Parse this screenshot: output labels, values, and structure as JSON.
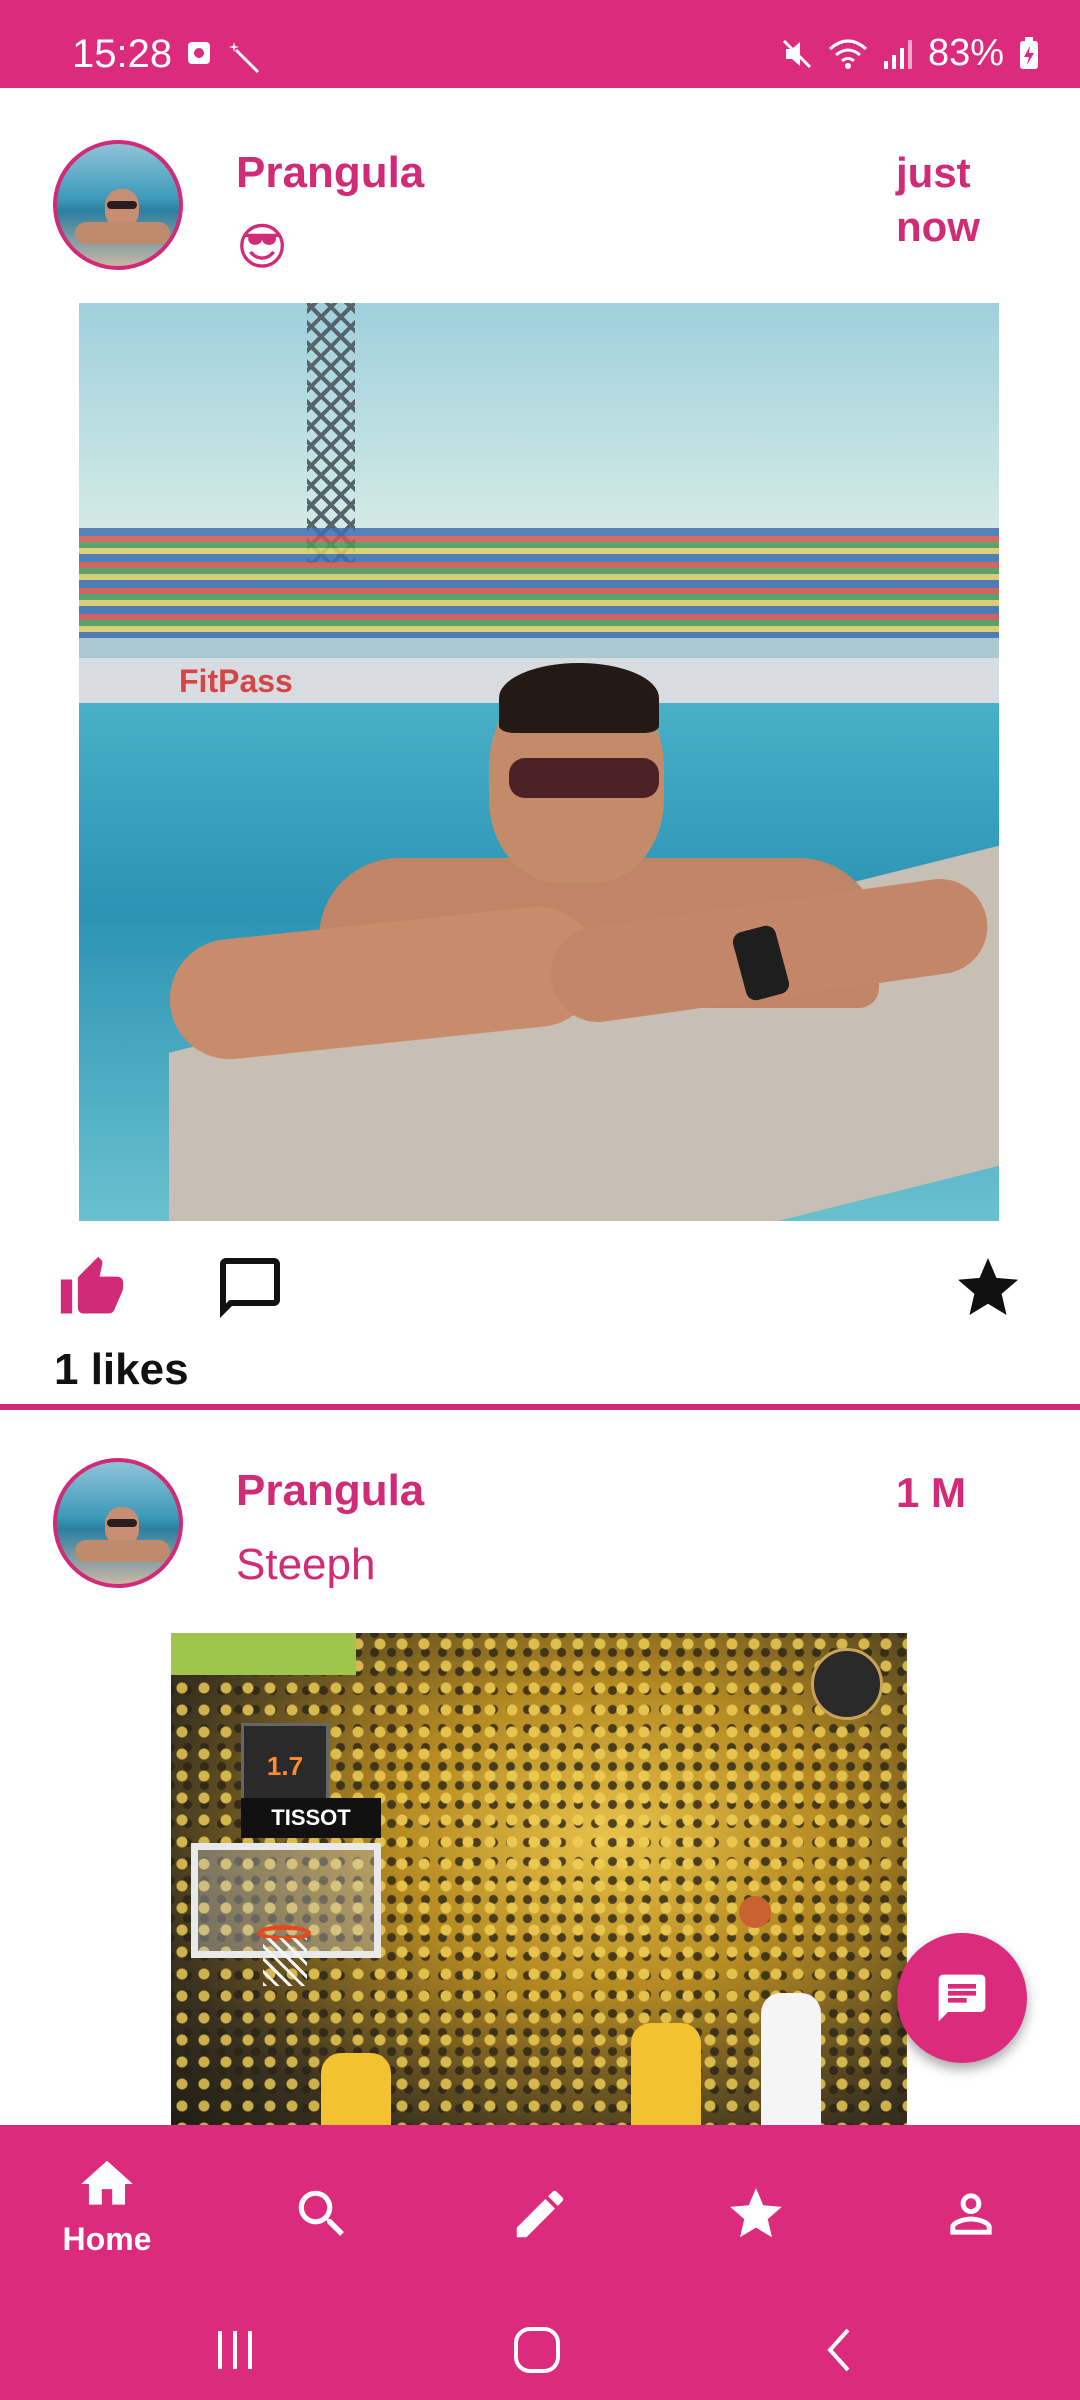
{
  "status_bar": {
    "time": "15:28",
    "battery": "83%",
    "icons": [
      "screen-record-icon",
      "magic-wand-icon",
      "mute-icon",
      "wifi-icon",
      "signal-icon",
      "battery-charging-icon"
    ]
  },
  "posts": [
    {
      "username": "Prangula",
      "caption": "😎",
      "timestamp": "just now",
      "image_alt": "man in sunglasses leaning on pool edge",
      "likes_text": "1 likes"
    },
    {
      "username": "Prangula",
      "caption": "Steeph",
      "timestamp": "1 M",
      "image_alt": "basketball player shooting in arena"
    }
  ],
  "pool_photo": {
    "banner_text": "FitPass"
  },
  "court_photo": {
    "shot_clock": "1.7",
    "sponsor": "TISSOT"
  },
  "actions": {
    "like_icon": "thumb-up-icon",
    "comment_icon": "comment-icon",
    "favorite_icon": "star-icon"
  },
  "bottom_nav": {
    "items": [
      {
        "label": "Home",
        "icon": "home-icon",
        "active": true
      },
      {
        "label": "",
        "icon": "search-icon"
      },
      {
        "label": "",
        "icon": "edit-icon"
      },
      {
        "label": "",
        "icon": "star-icon"
      },
      {
        "label": "",
        "icon": "profile-icon"
      }
    ]
  },
  "colors": {
    "accent": "#dc2a7c",
    "text_accent": "#d12a77",
    "background": "#ffffff"
  }
}
